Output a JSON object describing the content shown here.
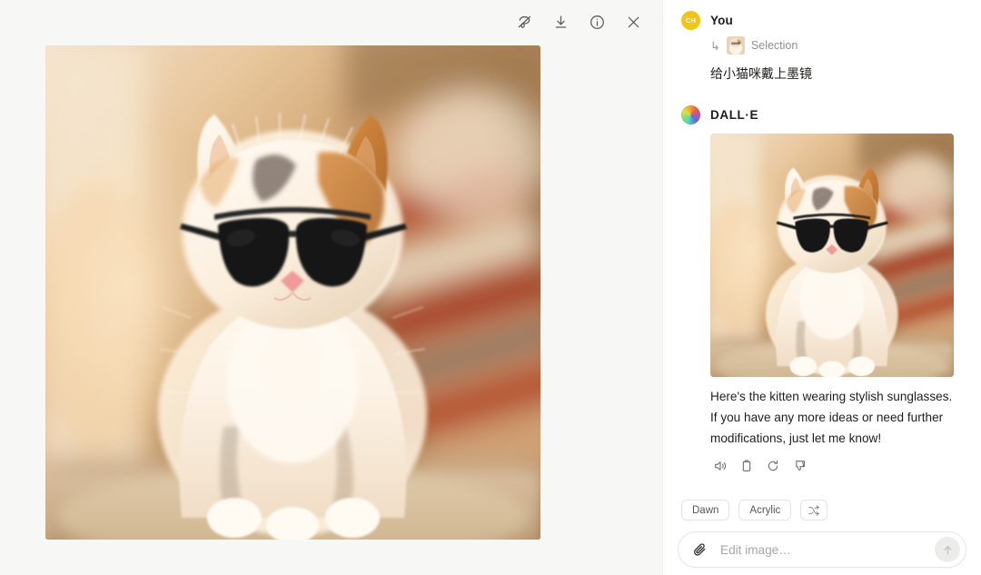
{
  "viewer": {
    "toolbar": [
      {
        "name": "clear-selection-icon",
        "label": "Clear selection"
      },
      {
        "name": "download-icon",
        "label": "Download"
      },
      {
        "name": "info-icon",
        "label": "Image info"
      },
      {
        "name": "close-icon",
        "label": "Close"
      }
    ],
    "image_alt": "Fluffy calico kitten wearing black aviator sunglasses sitting on a carpet"
  },
  "chat": {
    "messages": [
      {
        "sender": "You",
        "avatar_initials": "CH",
        "avatar_color": "#f0c419",
        "attachment": {
          "label": "Selection",
          "arrow": "↳"
        },
        "text": "给小猫咪戴上墨镜"
      },
      {
        "sender": "DALL·E",
        "avatar_type": "color-wheel",
        "image_alt": "Generated kitten wearing sunglasses",
        "text": "Here's the kitten wearing stylish sunglasses. If you have any more ideas or need further modifications, just let me know!",
        "actions": [
          {
            "name": "read-aloud-icon",
            "label": "Read aloud"
          },
          {
            "name": "copy-icon",
            "label": "Copy"
          },
          {
            "name": "regenerate-icon",
            "label": "Regenerate"
          },
          {
            "name": "thumbs-down-icon",
            "label": "Bad response"
          }
        ]
      }
    ],
    "chips": [
      {
        "label": "Dawn",
        "type": "text"
      },
      {
        "label": "Acrylic",
        "type": "text"
      },
      {
        "label": "",
        "type": "shuffle-icon"
      }
    ],
    "composer": {
      "placeholder": "Edit image…",
      "value": "",
      "attach_label": "Attach file",
      "send_label": "Send"
    }
  }
}
